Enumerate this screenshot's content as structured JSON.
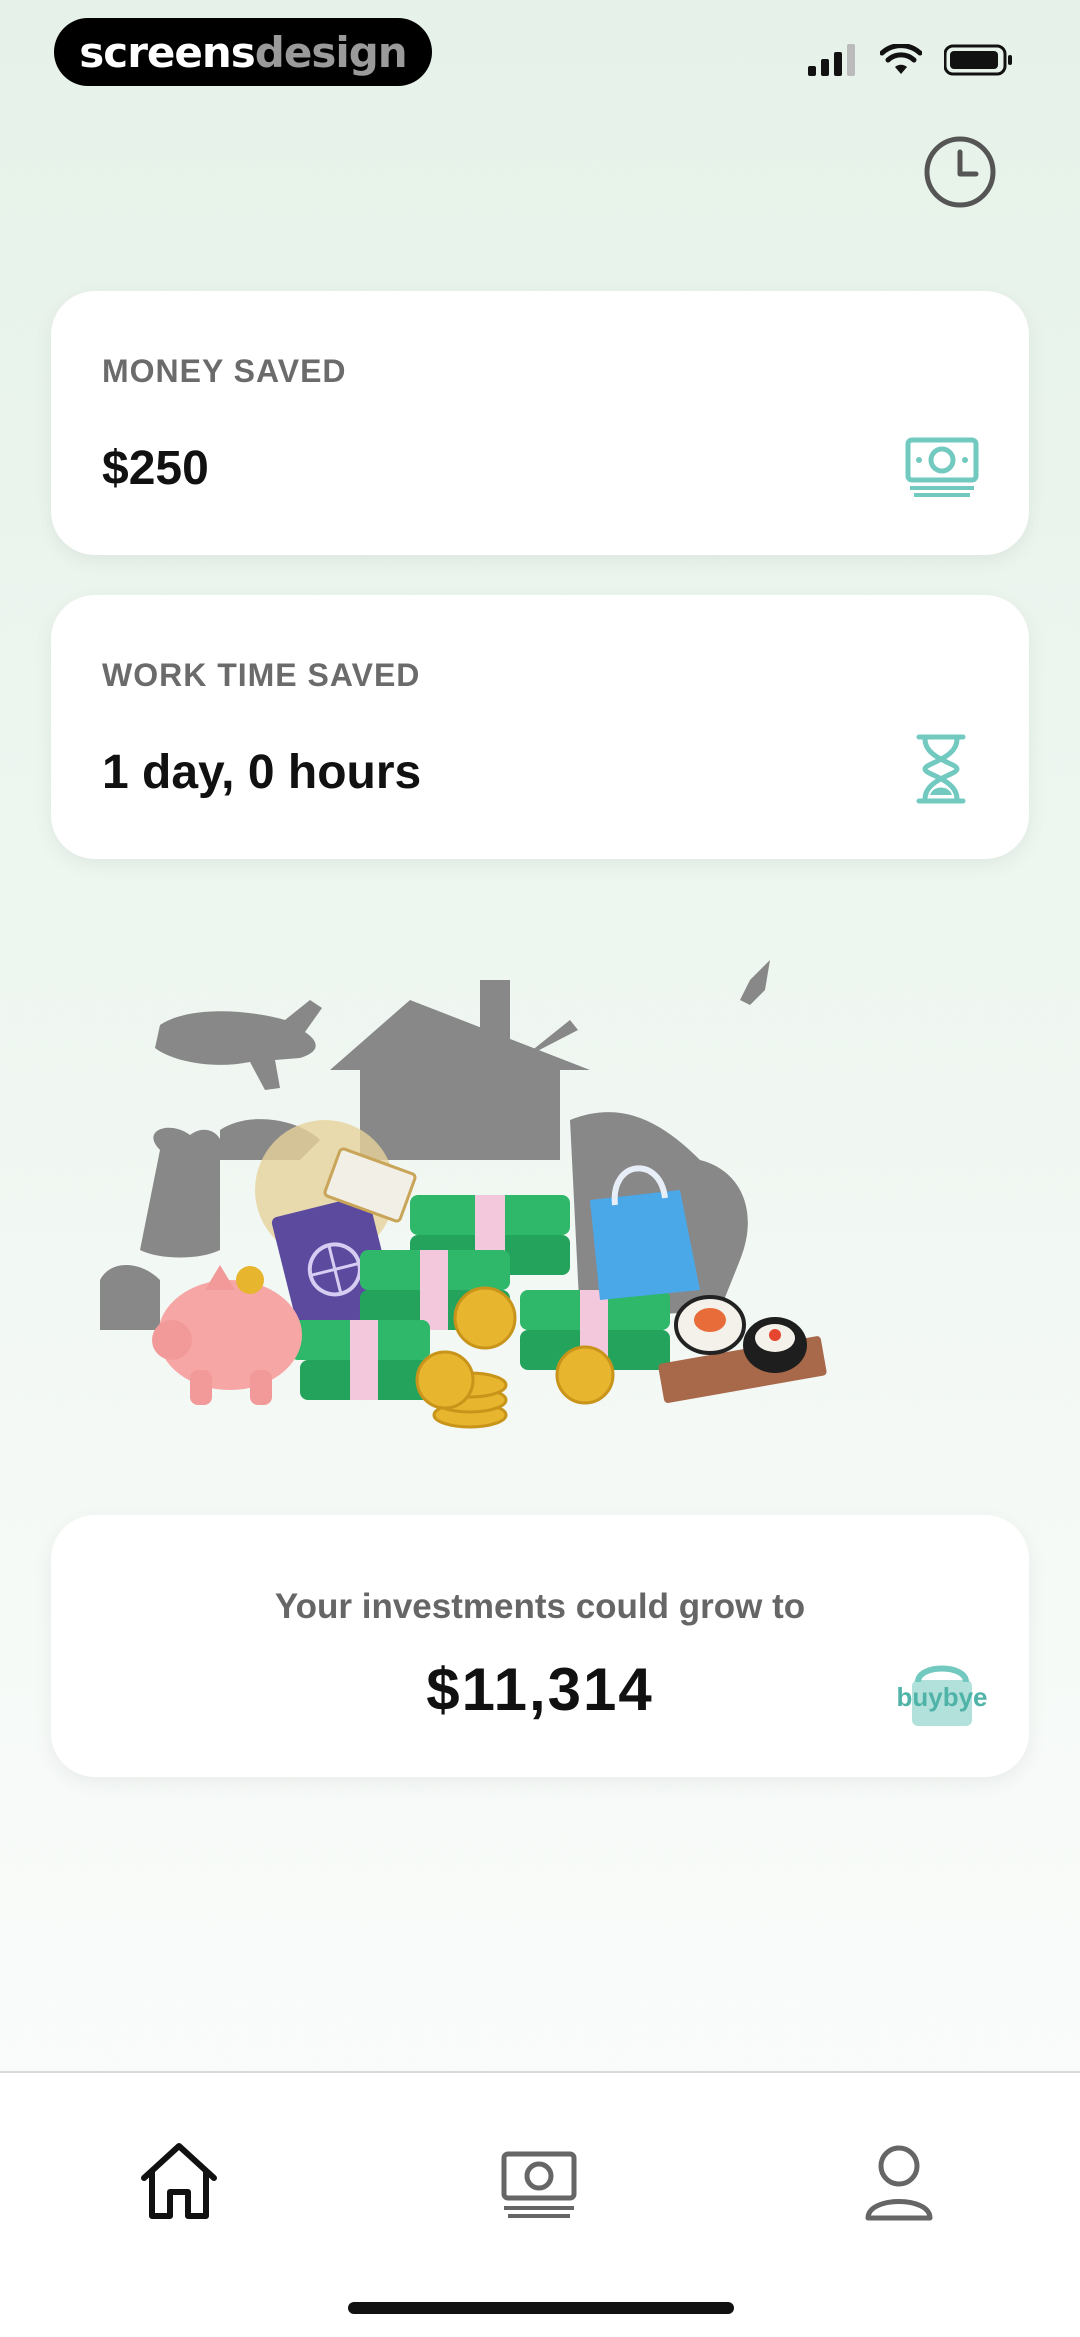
{
  "watermark": {
    "part1": "screens",
    "part2": "design"
  },
  "status_bar": {
    "signal_icon": "signal-bars-icon",
    "wifi_icon": "wifi-icon",
    "battery_icon": "battery-icon"
  },
  "header": {
    "history_icon": "clock-icon"
  },
  "money_card": {
    "label": "MONEY SAVED",
    "value": "$250",
    "icon": "banknote-icon"
  },
  "time_card": {
    "label": "WORK TIME SAVED",
    "value": "1 day, 0 hours",
    "icon": "hourglass-icon"
  },
  "invest_card": {
    "label": "Your investments could grow to",
    "value": "$11,314",
    "logo": "buybye"
  },
  "tabbar": {
    "items": [
      "home-icon",
      "money-icon",
      "profile-icon"
    ],
    "active": 0
  },
  "colors": {
    "accent": "#72c9c0",
    "text": "#111111",
    "label": "#6b6b6b",
    "bg_top": "#e6f2e9"
  }
}
